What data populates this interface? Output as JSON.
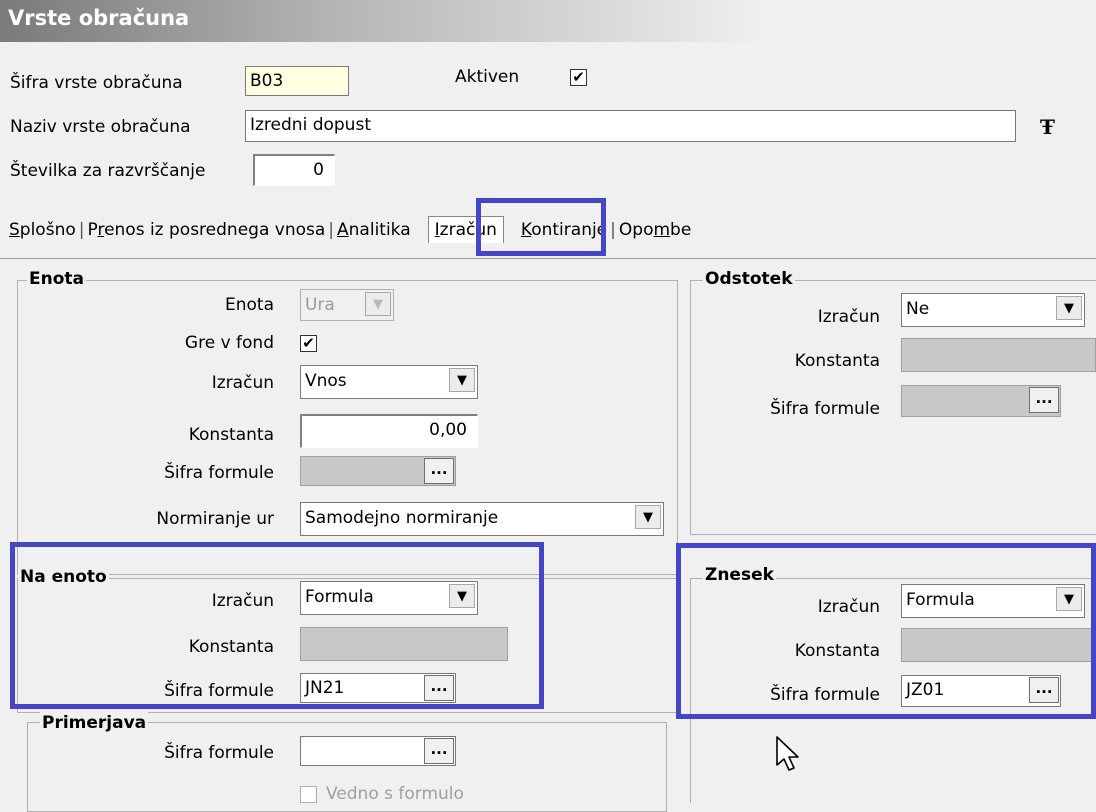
{
  "window": {
    "title": "Vrste obračuna"
  },
  "header": {
    "sifra_label": "Šifra vrste obračuna",
    "sifra_value": "B03",
    "aktiven_label": "Aktiven",
    "aktiven_checked": "✔",
    "naziv_label": "Naziv vrste obračuna",
    "naziv_value": "Izredni dopust",
    "tt_icon": "Ŧ",
    "stevilka_label": "Številka  za razvrščanje",
    "stevilka_value": "0"
  },
  "tabs": [
    {
      "u": "S",
      "rest": "plošno"
    },
    {
      "pre": "P",
      "u": "r",
      "rest": "enos iz posrednega vnosa"
    },
    {
      "u": "A",
      "rest": "nalitika"
    },
    {
      "u": "I",
      "rest": "zračun"
    },
    {
      "u": "K",
      "rest": "ontiranje"
    },
    {
      "pre": "Opo",
      "u": "m",
      "rest": "be"
    }
  ],
  "enota": {
    "title": "Enota",
    "enota_label": "Enota",
    "enota_value": "Ura",
    "gre_v_fond_label": "Gre v fond",
    "gre_v_fond_checked": "✔",
    "izracun_label": "Izračun",
    "izracun_value": "Vnos",
    "konstanta_label": "Konstanta",
    "konstanta_value": "0,00",
    "sifra_formule_label": "Šifra formule",
    "sifra_formule_value": "",
    "normiranje_label": "Normiranje ur",
    "normiranje_value": "Samodejno normiranje"
  },
  "na_enoto": {
    "title": "Na enoto",
    "izracun_label": "Izračun",
    "izracun_value": "Formula",
    "konstanta_label": "Konstanta",
    "sifra_formule_label": "Šifra formule",
    "sifra_formule_value": "JN21"
  },
  "primerjava": {
    "title": "Primerjava",
    "sifra_formule_label": "Šifra formule",
    "sifra_formule_value": "",
    "vedno_label": "Vedno s formulo"
  },
  "odstotek": {
    "title": "Odstotek",
    "izracun_label": "Izračun",
    "izracun_value": "Ne",
    "konstanta_label": "Konstanta",
    "sifra_formule_label": "Šifra formule",
    "sifra_formule_value": ""
  },
  "znesek": {
    "title": "Znesek",
    "izracun_label": "Izračun",
    "izracun_value": "Formula",
    "konstanta_label": "Konstanta",
    "sifra_formule_label": "Šifra formule",
    "sifra_formule_value": "JZ01"
  },
  "common": {
    "dropdown_glyph": "▼",
    "ellipsis_glyph": "..."
  },
  "colors": {
    "highlight": "#4545c8"
  }
}
